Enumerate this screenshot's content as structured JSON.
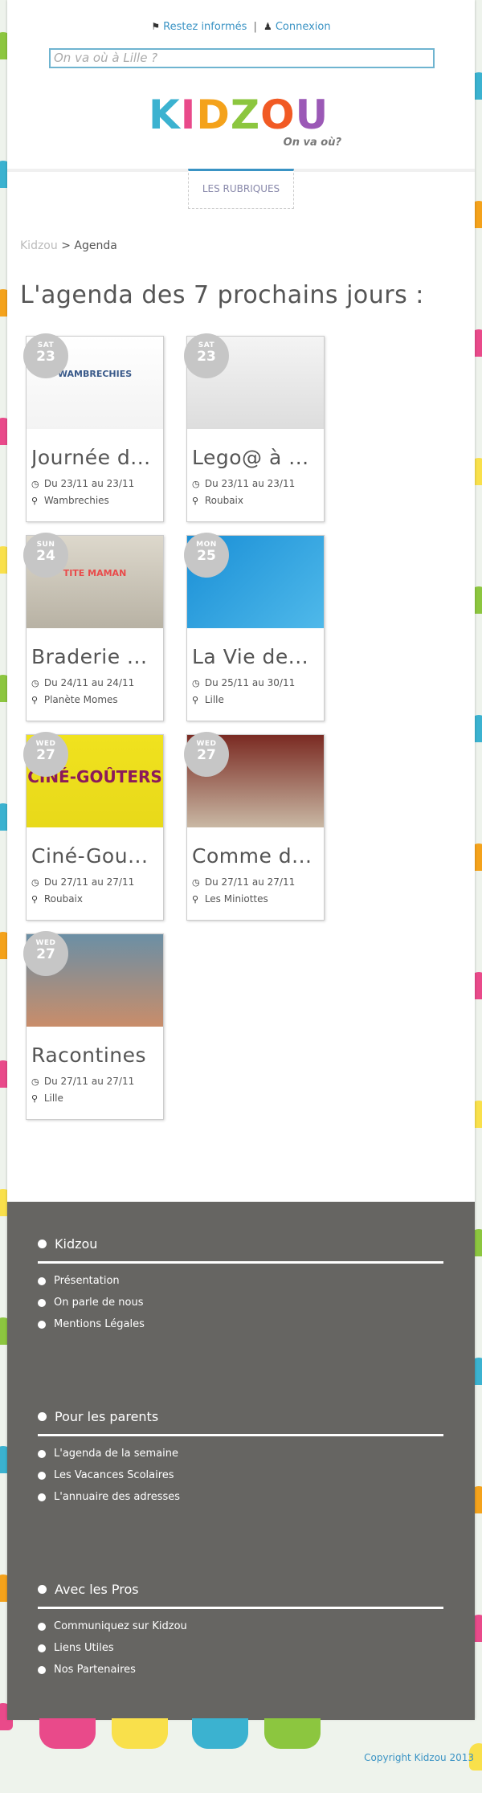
{
  "header": {
    "newsletter_icon": "bookmark-icon",
    "newsletter_label": "Restez informés",
    "separator": "|",
    "login_icon": "user-icon",
    "login_label": "Connexion",
    "search_placeholder": "On va où à Lille ?"
  },
  "logo": {
    "letters": [
      "K",
      "I",
      "D",
      "Z",
      "O",
      "U"
    ],
    "letter_colors": [
      "#3bb2d0",
      "#e94a8a",
      "#f4a21b",
      "#8cc63f",
      "#f15a24",
      "#9b59b6"
    ],
    "tagline": "On va où?"
  },
  "nav": {
    "rubriques_label": "LES RUBRIQUES"
  },
  "breadcrumb": {
    "home": "Kidzou",
    "sep": ">",
    "current": "Agenda"
  },
  "page_title": "L'agenda des 7 prochains jours :",
  "events": [
    {
      "dow": "SAT",
      "day": "23",
      "title": "Journée d...",
      "dates": "Du 23/11 au 23/11",
      "place": "Wambrechies",
      "img": "wambrechies-logo",
      "img_text": "WAMBRECHIES"
    },
    {
      "dow": "SAT",
      "day": "23",
      "title": "Lego@ à ...",
      "dates": "Du 23/11 au 23/11",
      "place": "Roubaix",
      "img": "lego-figure",
      "img_text": ""
    },
    {
      "dow": "SUN",
      "day": "24",
      "title": "Braderie ...",
      "dates": "Du 24/11 au 24/11",
      "place": "Planète Momes",
      "img": "braderie-poster",
      "img_text": "TITE MAMAN"
    },
    {
      "dow": "MON",
      "day": "25",
      "title": "La Vie de...",
      "dates": "Du 25/11 au 30/11",
      "place": "Lille",
      "img": "puppet-bird",
      "img_text": ""
    },
    {
      "dow": "WED",
      "day": "27",
      "title": "Ciné-Gou...",
      "dates": "Du 27/11 au 27/11",
      "place": "Roubaix",
      "img": "cine-gouters-poster",
      "img_text": "CINÉ-GOÛTERS"
    },
    {
      "dow": "WED",
      "day": "27",
      "title": "Comme d...",
      "dates": "Du 27/11 au 27/11",
      "place": "Les Miniottes",
      "img": "theatre-set",
      "img_text": ""
    },
    {
      "dow": "WED",
      "day": "27",
      "title": "Racontines",
      "dates": "Du 27/11 au 27/11",
      "place": "Lille",
      "img": "toys-table",
      "img_text": ""
    }
  ],
  "event_icons": {
    "clock": "clock-icon",
    "pin": "map-marker-icon"
  },
  "footer": {
    "sections": [
      {
        "title": "Kidzou",
        "items": [
          "Présentation",
          "On parle de nous",
          "Mentions Légales"
        ]
      },
      {
        "title": "Pour les parents",
        "items": [
          "L'agenda de la semaine",
          "Les Vacances Scolaires",
          "L'annuaire des adresses"
        ]
      },
      {
        "title": "Avec les Pros",
        "items": [
          "Communiquez sur Kidzou",
          "Liens Utiles",
          "Nos Partenaires"
        ]
      }
    ],
    "copyright": "Copyright Kidzou 2013"
  },
  "colors": {
    "accent": "#3a93c4",
    "footer_bg": "#666562",
    "badge": "#c6c6c6"
  }
}
